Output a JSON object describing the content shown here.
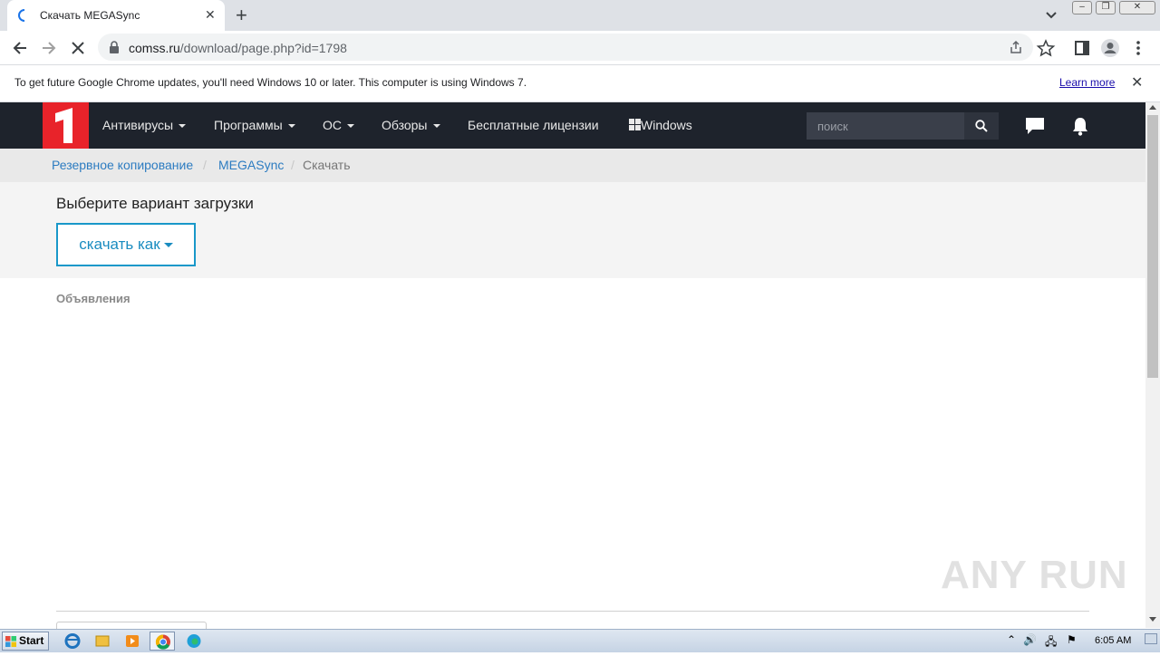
{
  "browser": {
    "tab_title": "Скачать MEGASync",
    "url_host": "comss.ru",
    "url_path": "/download/page.php?id=1798",
    "infobar_text": "To get future Google Chrome updates, you'll need Windows 10 or later. This computer is using Windows 7.",
    "learn_more": "Learn more"
  },
  "site": {
    "nav": [
      {
        "label": "Антивирусы",
        "dropdown": true
      },
      {
        "label": "Программы",
        "dropdown": true
      },
      {
        "label": "ОС",
        "dropdown": true
      },
      {
        "label": "Обзоры",
        "dropdown": true
      },
      {
        "label": "Бесплатные лицензии",
        "dropdown": false
      },
      {
        "label": "Windows",
        "dropdown": false
      }
    ],
    "search_placeholder": "поиск",
    "logo_color": "#e8232a",
    "nav_bg": "#1e232c"
  },
  "breadcrumb": {
    "items": [
      "Резервное копирование",
      "MEGASync",
      "Скачать"
    ],
    "separator": "/"
  },
  "download": {
    "heading": "Выберите вариант загрузки",
    "button_label": "скачать как",
    "accent": "#1998c9"
  },
  "ads_label": "Объявления",
  "watermark": "ANY RUN",
  "taskbar": {
    "start_label": "Start",
    "clock": "6:05 AM"
  }
}
